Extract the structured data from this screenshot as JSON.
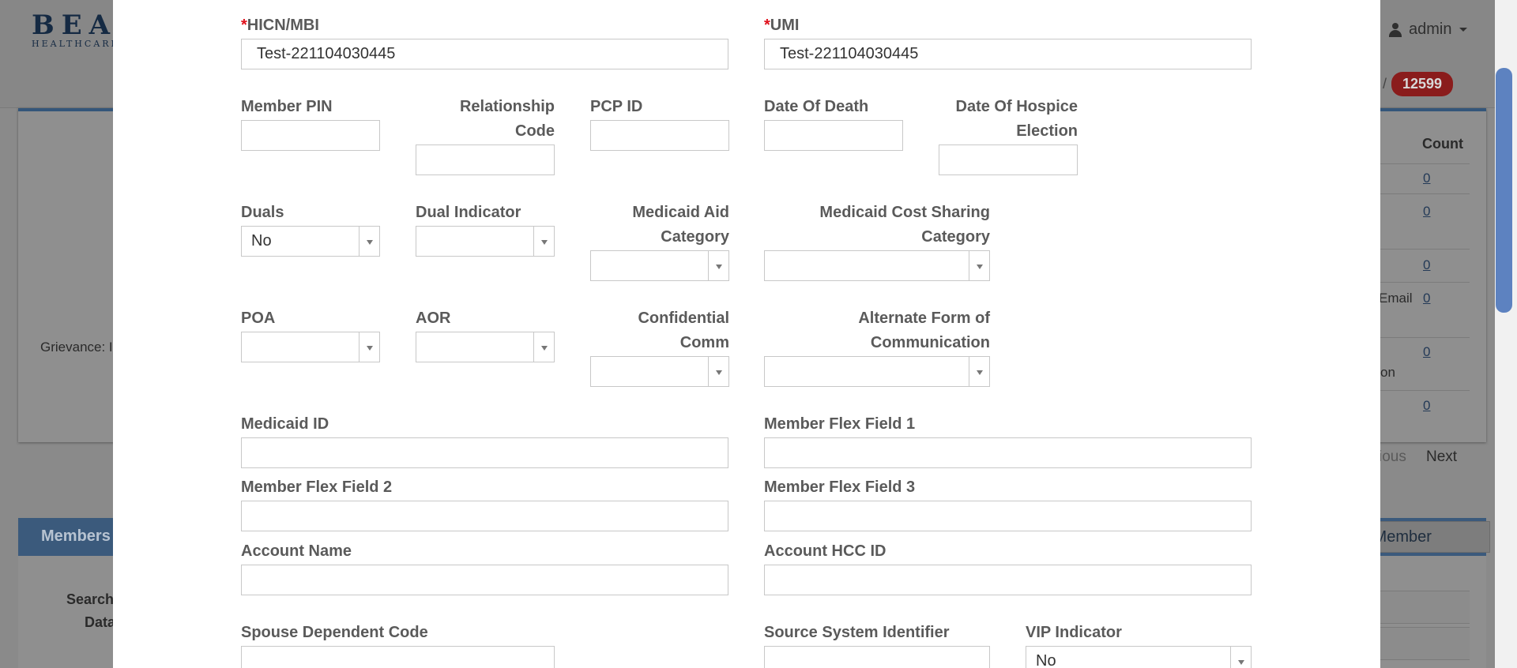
{
  "background": {
    "logo_main": "BEAC",
    "logo_sub": "HEALTHCARE",
    "user_label": "admin",
    "counter_value": "12599",
    "counter_slash": "/",
    "grievance_label": "Grievance: I",
    "count_header": "Count",
    "count_values": [
      "0",
      "0",
      "0",
      "0",
      "0",
      "0"
    ],
    "row_fragments": [
      "Email",
      "on"
    ],
    "pagination_prev": "ious",
    "pagination_next": "Next",
    "members_header": "Members",
    "add_member_label": "v Member",
    "search_label": "Search",
    "data_label": "Data"
  },
  "form": {
    "hicn_label": "HICN/MBI",
    "hicn_value": "Test-221104030445",
    "umi_label": "UMI",
    "umi_value": "Test-221104030445",
    "required_marker": "*",
    "member_pin_label": "Member PIN",
    "relationship_code_label_1": "Relationship",
    "relationship_code_label_2": "Code",
    "pcp_id_label": "PCP ID",
    "date_of_death_label": "Date Of Death",
    "hospice_label_1": "Date Of Hospice",
    "hospice_label_2": "Election",
    "duals_label": "Duals",
    "duals_value": "No",
    "dual_indicator_label": "Dual Indicator",
    "medicaid_aid_label_1": "Medicaid Aid",
    "medicaid_aid_label_2": "Category",
    "medicaid_cost_label_1": "Medicaid Cost Sharing",
    "medicaid_cost_label_2": "Category",
    "poa_label": "POA",
    "aor_label": "AOR",
    "confidential_label_1": "Confidential",
    "confidential_label_2": "Comm",
    "alt_form_label_1": "Alternate Form of",
    "alt_form_label_2": "Communication",
    "medicaid_id_label": "Medicaid ID",
    "flex1_label": "Member Flex Field 1",
    "flex2_label": "Member Flex Field 2",
    "flex3_label": "Member Flex Field 3",
    "account_name_label": "Account Name",
    "account_hcc_label": "Account HCC ID",
    "spouse_label": "Spouse Dependent Code",
    "source_system_label": "Source System Identifier",
    "vip_label": "VIP Indicator",
    "vip_value": "No"
  }
}
